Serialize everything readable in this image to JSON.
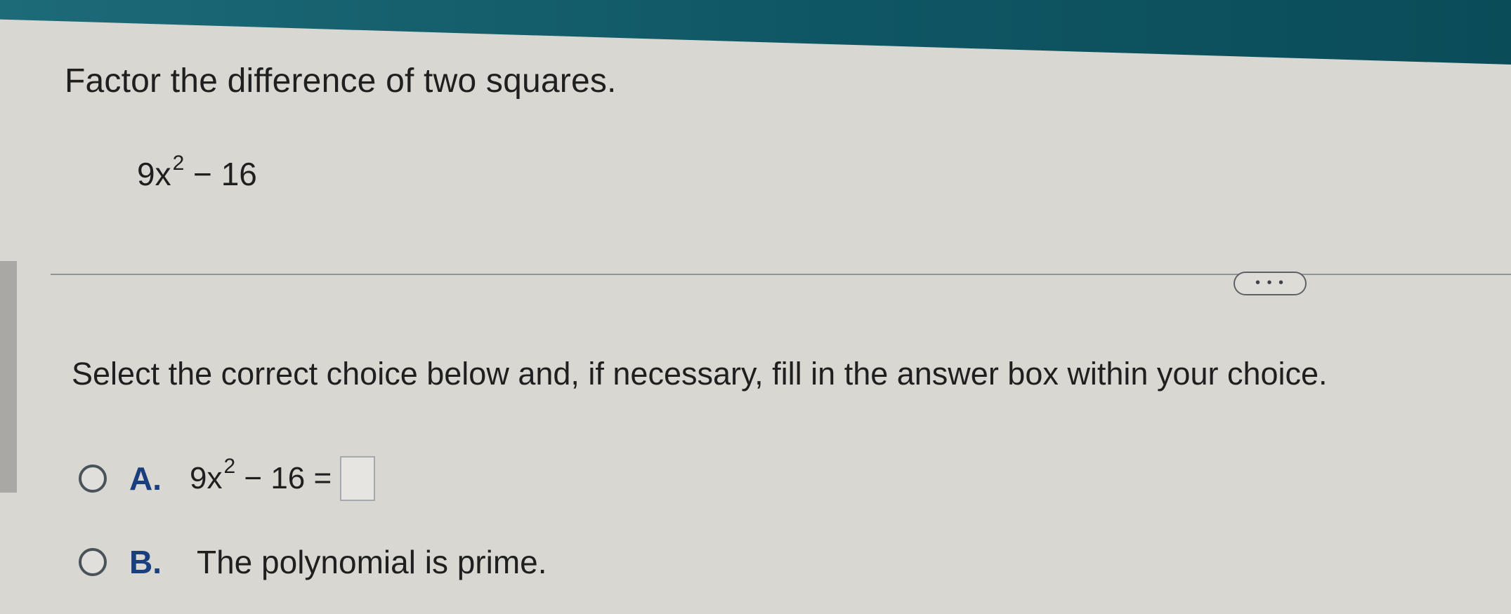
{
  "question": {
    "title": "Factor the difference of two squares.",
    "expression": {
      "base": "9x",
      "exponent": "2",
      "rest": " − 16"
    }
  },
  "more_button": {
    "label": "• • •"
  },
  "instruction": "Select the correct choice below and, if necessary, fill in the answer box within your choice.",
  "choices": [
    {
      "letter": "A.",
      "expr_base": "9x",
      "expr_exponent": "2",
      "expr_rest": " − 16 =",
      "answer_value": ""
    },
    {
      "letter": "B.",
      "text": "The polynomial is prime."
    }
  ],
  "colors": {
    "header": "#0f5664",
    "choice_letter": "#193f7e",
    "background": "#d9d7d1"
  }
}
